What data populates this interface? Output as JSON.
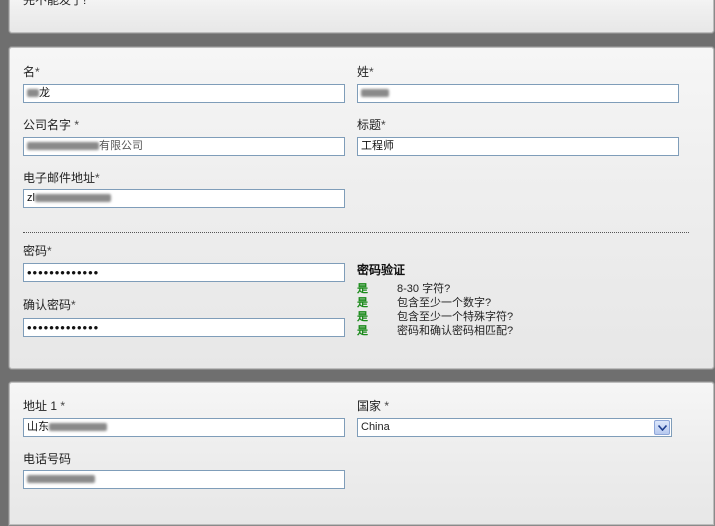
{
  "top_panel": {
    "text": "完不能发了!"
  },
  "account": {
    "first_name": {
      "label": "名",
      "required": "*",
      "value_visible": "",
      "value_tail": "龙"
    },
    "last_name": {
      "label": "姓",
      "required": "*",
      "value_visible": ""
    },
    "company": {
      "label": "公司名字 ",
      "required": "*",
      "value_tail": "有限公司"
    },
    "title": {
      "label": "标题",
      "required": "*",
      "value": "工程师"
    },
    "email": {
      "label": "电子邮件地址",
      "required": "*",
      "value_head": "zl"
    },
    "password": {
      "label": "密码",
      "required": "*",
      "value": "•••••••••••••"
    },
    "confirm_password": {
      "label": "确认密码",
      "required": "*",
      "value": "•••••••••••••"
    },
    "validation": {
      "title": "密码验证",
      "rows": [
        {
          "status": "是",
          "text": "8-30 字符?"
        },
        {
          "status": "是",
          "text": "包含至少一个数字?"
        },
        {
          "status": "是",
          "text": "包含至少一个特殊字符?"
        },
        {
          "status": "是",
          "text": "密码和确认密码相匹配?"
        }
      ],
      "status_color": "#1a8a1a"
    }
  },
  "contact": {
    "address1": {
      "label": "地址 1",
      "required": "*",
      "value_head": "山东"
    },
    "country": {
      "label": "国家 ",
      "required": "*",
      "value": "China"
    },
    "phone": {
      "label": "电话号码",
      "required": "",
      "value_visible": ""
    }
  }
}
